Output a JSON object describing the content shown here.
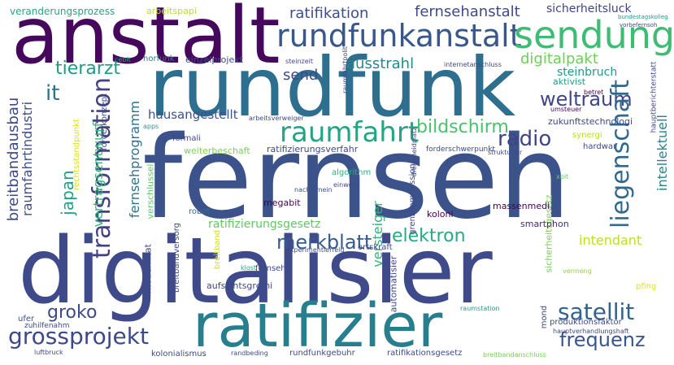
{
  "words": [
    {
      "text": "fernseh",
      "color": "#3b528b"
    },
    {
      "text": "digitalisier",
      "color": "#3e4a89"
    },
    {
      "text": "rundfunk",
      "color": "#2e6e8e"
    },
    {
      "text": "anstalt",
      "color": "#46085c"
    },
    {
      "text": "ratifizier",
      "color": "#277f8e"
    },
    {
      "text": "rundfunkanstalt",
      "color": "#38588c"
    },
    {
      "text": "sendung",
      "color": "#3fbc73"
    },
    {
      "text": "transformation",
      "color": "#424186"
    },
    {
      "text": "raumfahrt",
      "color": "#21a685"
    },
    {
      "text": "liegenschaft",
      "color": "#31688e"
    },
    {
      "text": "grossprojekt",
      "color": "#3e4989"
    },
    {
      "text": "breitbandausbau",
      "color": "#3e4989"
    },
    {
      "text": "satellit",
      "color": "#33638d"
    },
    {
      "text": "merkblatt",
      "color": "#365c8d"
    },
    {
      "text": "fernsehanstalt",
      "color": "#3e4a89"
    },
    {
      "text": "ratifikation",
      "color": "#3d4e8a"
    },
    {
      "text": "japan",
      "color": "#1fa088"
    },
    {
      "text": "frequenz",
      "color": "#3a548c"
    },
    {
      "text": "radio",
      "color": "#414487"
    },
    {
      "text": "bildschirm",
      "color": "#4ac16d"
    },
    {
      "text": "weltraum",
      "color": "#404688"
    },
    {
      "text": "elektron",
      "color": "#25ab82"
    },
    {
      "text": "fernsehprogramm",
      "color": "#2c728e"
    },
    {
      "text": "raumfahrtindustri",
      "color": "#3d4e8a"
    },
    {
      "text": "vertragsentwurf",
      "color": "#35b779"
    },
    {
      "text": "intellektuell",
      "color": "#25848e"
    },
    {
      "text": "tierarzt",
      "color": "#1e9c89"
    },
    {
      "text": "digitalpakt",
      "color": "#6ece58"
    },
    {
      "text": "ausstrahl",
      "color": "#23898e"
    },
    {
      "text": "versteiger",
      "color": "#31b57b"
    },
    {
      "text": "groko",
      "color": "#3e4a89"
    },
    {
      "text": "it",
      "color": "#2c728e"
    },
    {
      "text": "send",
      "color": "#3e4989"
    },
    {
      "text": "hausangestellt",
      "color": "#3b528b"
    },
    {
      "text": "intendant",
      "color": "#bddf26"
    },
    {
      "text": "ratifizierungsgesetz",
      "color": "#5ec962"
    },
    {
      "text": "steinbruch",
      "color": "#1f9a8a"
    },
    {
      "text": "aktivist",
      "color": "#1f9e89"
    },
    {
      "text": "sicherheitsluck",
      "color": "#414487"
    },
    {
      "text": "veranderungsprozess",
      "color": "#22a884"
    },
    {
      "text": "arbeitspapi",
      "color": "#b5de2b"
    },
    {
      "text": "einzelprojekt",
      "color": "#3e4a89"
    },
    {
      "text": "horfunk",
      "color": "#2a788e"
    },
    {
      "text": "cebit",
      "color": "#20a486"
    },
    {
      "text": "steinzeit",
      "color": "#3e4989"
    },
    {
      "text": "internetanschluss",
      "color": "#3e4989"
    },
    {
      "text": "megabit",
      "color": "#440154"
    },
    {
      "text": "koloni",
      "color": "#440154"
    },
    {
      "text": "massenmedi",
      "color": "#440154"
    },
    {
      "text": "smartphon",
      "color": "#482878"
    },
    {
      "text": "algorithm",
      "color": "#2db27d"
    },
    {
      "text": "einweih",
      "color": "#3e4a89"
    },
    {
      "text": "nachhimein",
      "color": "#3b528b"
    },
    {
      "text": "robot",
      "color": "#2e6f8e"
    },
    {
      "text": "formali",
      "color": "#3e4989"
    },
    {
      "text": "apps",
      "color": "#1f9e89"
    },
    {
      "text": "weiterbeschaft",
      "color": "#7ad151"
    },
    {
      "text": "ratifizierungsverfahr",
      "color": "#3e4a89"
    },
    {
      "text": "forderschwerpunkt",
      "color": "#3e4989"
    },
    {
      "text": "zukunftstechnologi",
      "color": "#3e4989"
    },
    {
      "text": "synergi",
      "color": "#b8de29"
    },
    {
      "text": "hardwar",
      "color": "#3e4a89"
    },
    {
      "text": "umsteuer",
      "color": "#440154"
    },
    {
      "text": "betret",
      "color": "#440154"
    },
    {
      "text": "arbeitsverweiger",
      "color": "#3e4989"
    },
    {
      "text": "forderkonzept",
      "color": "#3e4989"
    },
    {
      "text": "verschlussel",
      "color": "#5ec962"
    },
    {
      "text": "rechtsstandpunkt",
      "color": "#d8e219"
    },
    {
      "text": "modernitat",
      "color": "#3e4a89"
    },
    {
      "text": "breitbandversorg",
      "color": "#3e4989"
    },
    {
      "text": "breitband",
      "color": "#d0e11c"
    },
    {
      "text": "aufsichtsgremi",
      "color": "#3e4989"
    },
    {
      "text": "klost",
      "color": "#20a386"
    },
    {
      "text": "experimentierfeld",
      "color": "#3e4989"
    },
    {
      "text": "ortskraft",
      "color": "#3e4989"
    },
    {
      "text": "fernsehs",
      "color": "#3e4989"
    },
    {
      "text": "ufer",
      "color": "#3b528b"
    },
    {
      "text": "zuhilfenahm",
      "color": "#3e4989"
    },
    {
      "text": "luftbruck",
      "color": "#3e4a89"
    },
    {
      "text": "kolonialismus",
      "color": "#3e4a89"
    },
    {
      "text": "randbeding",
      "color": "#3e4a89"
    },
    {
      "text": "rundfunkgebuhr",
      "color": "#3e4a89"
    },
    {
      "text": "ratifikationsgesetz",
      "color": "#3e4a89"
    },
    {
      "text": "breitbandanschluss",
      "color": "#73d056"
    },
    {
      "text": "raumstation",
      "color": "#1fa088"
    },
    {
      "text": "produktionsfaktor",
      "color": "#3e4989"
    },
    {
      "text": "hauptverhandlungshaft",
      "color": "#3e4989"
    },
    {
      "text": "mond",
      "color": "#3e4a89"
    },
    {
      "text": "automatisier",
      "color": "#3e4989"
    },
    {
      "text": "grenzkommission",
      "color": "#3e4989"
    },
    {
      "text": "sicherheitsgesetz",
      "color": "#7ad151"
    },
    {
      "text": "vermeng",
      "color": "#8fd744"
    },
    {
      "text": "pfing",
      "color": "#e0e318"
    },
    {
      "text": "xbit",
      "color": "#63cb5f"
    },
    {
      "text": "hauptberichterstatt",
      "color": "#3e4989"
    },
    {
      "text": "bundestagskolleg",
      "color": "#1f988b"
    },
    {
      "text": "vorbefernsoh",
      "color": "#3e4989"
    },
    {
      "text": "raumfahrtpolit",
      "color": "#3e4989"
    },
    {
      "text": "dreischeidplatz",
      "color": "#3e4989"
    },
    {
      "text": "strukturier",
      "color": "#3e4989"
    }
  ]
}
